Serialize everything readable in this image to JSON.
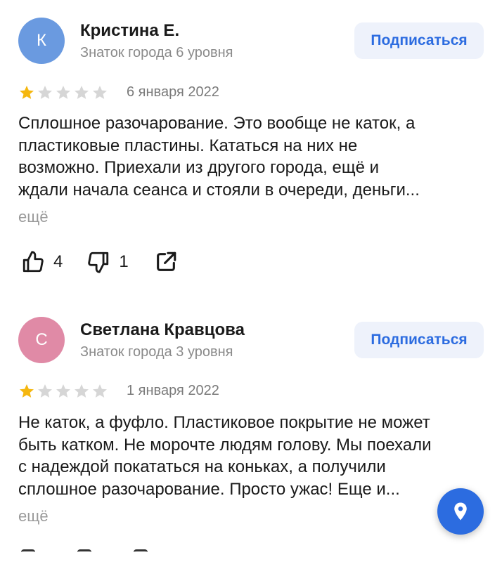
{
  "reviews": [
    {
      "avatar_letter": "К",
      "avatar_color": "#6a9ae0",
      "name": "Кристина Е.",
      "badge": "Знаток города 6 уровня",
      "subscribe_label": "Подписаться",
      "rating": 1,
      "date": "6 января 2022",
      "text_lines": [
        "Сплошное разочарование. Это вообще не каток, а",
        "пластиковые пластины. Кататься на них не",
        "возможно. Приехали из другого города, ещё и",
        "ждали начала сеанса и стояли в очереди, деньги..."
      ],
      "more_label": "ещё",
      "likes": "4",
      "dislikes": "1"
    },
    {
      "avatar_letter": "С",
      "avatar_color": "#e08aa6",
      "name": "Светлана Кравцова",
      "badge": "Знаток города 3 уровня",
      "subscribe_label": "Подписаться",
      "rating": 1,
      "date": "1 января 2022",
      "text_lines": [
        "Не каток, а фуфло. Пластиковое покрытие не может",
        "быть катком. Не морочте людям голову. Мы поехали",
        "с надеждой покататься на коньках, а получили",
        "сплошное разочарование. Просто ужас! Еще и..."
      ],
      "more_label": "ещё"
    }
  ],
  "colors": {
    "star_filled": "#f5b70f",
    "star_empty": "#d6d6d6",
    "accent": "#2c6ce0"
  },
  "icons": {
    "like": "thumbs-up-icon",
    "dislike": "thumbs-down-icon",
    "share": "share-icon",
    "fab": "map-pin-icon"
  }
}
